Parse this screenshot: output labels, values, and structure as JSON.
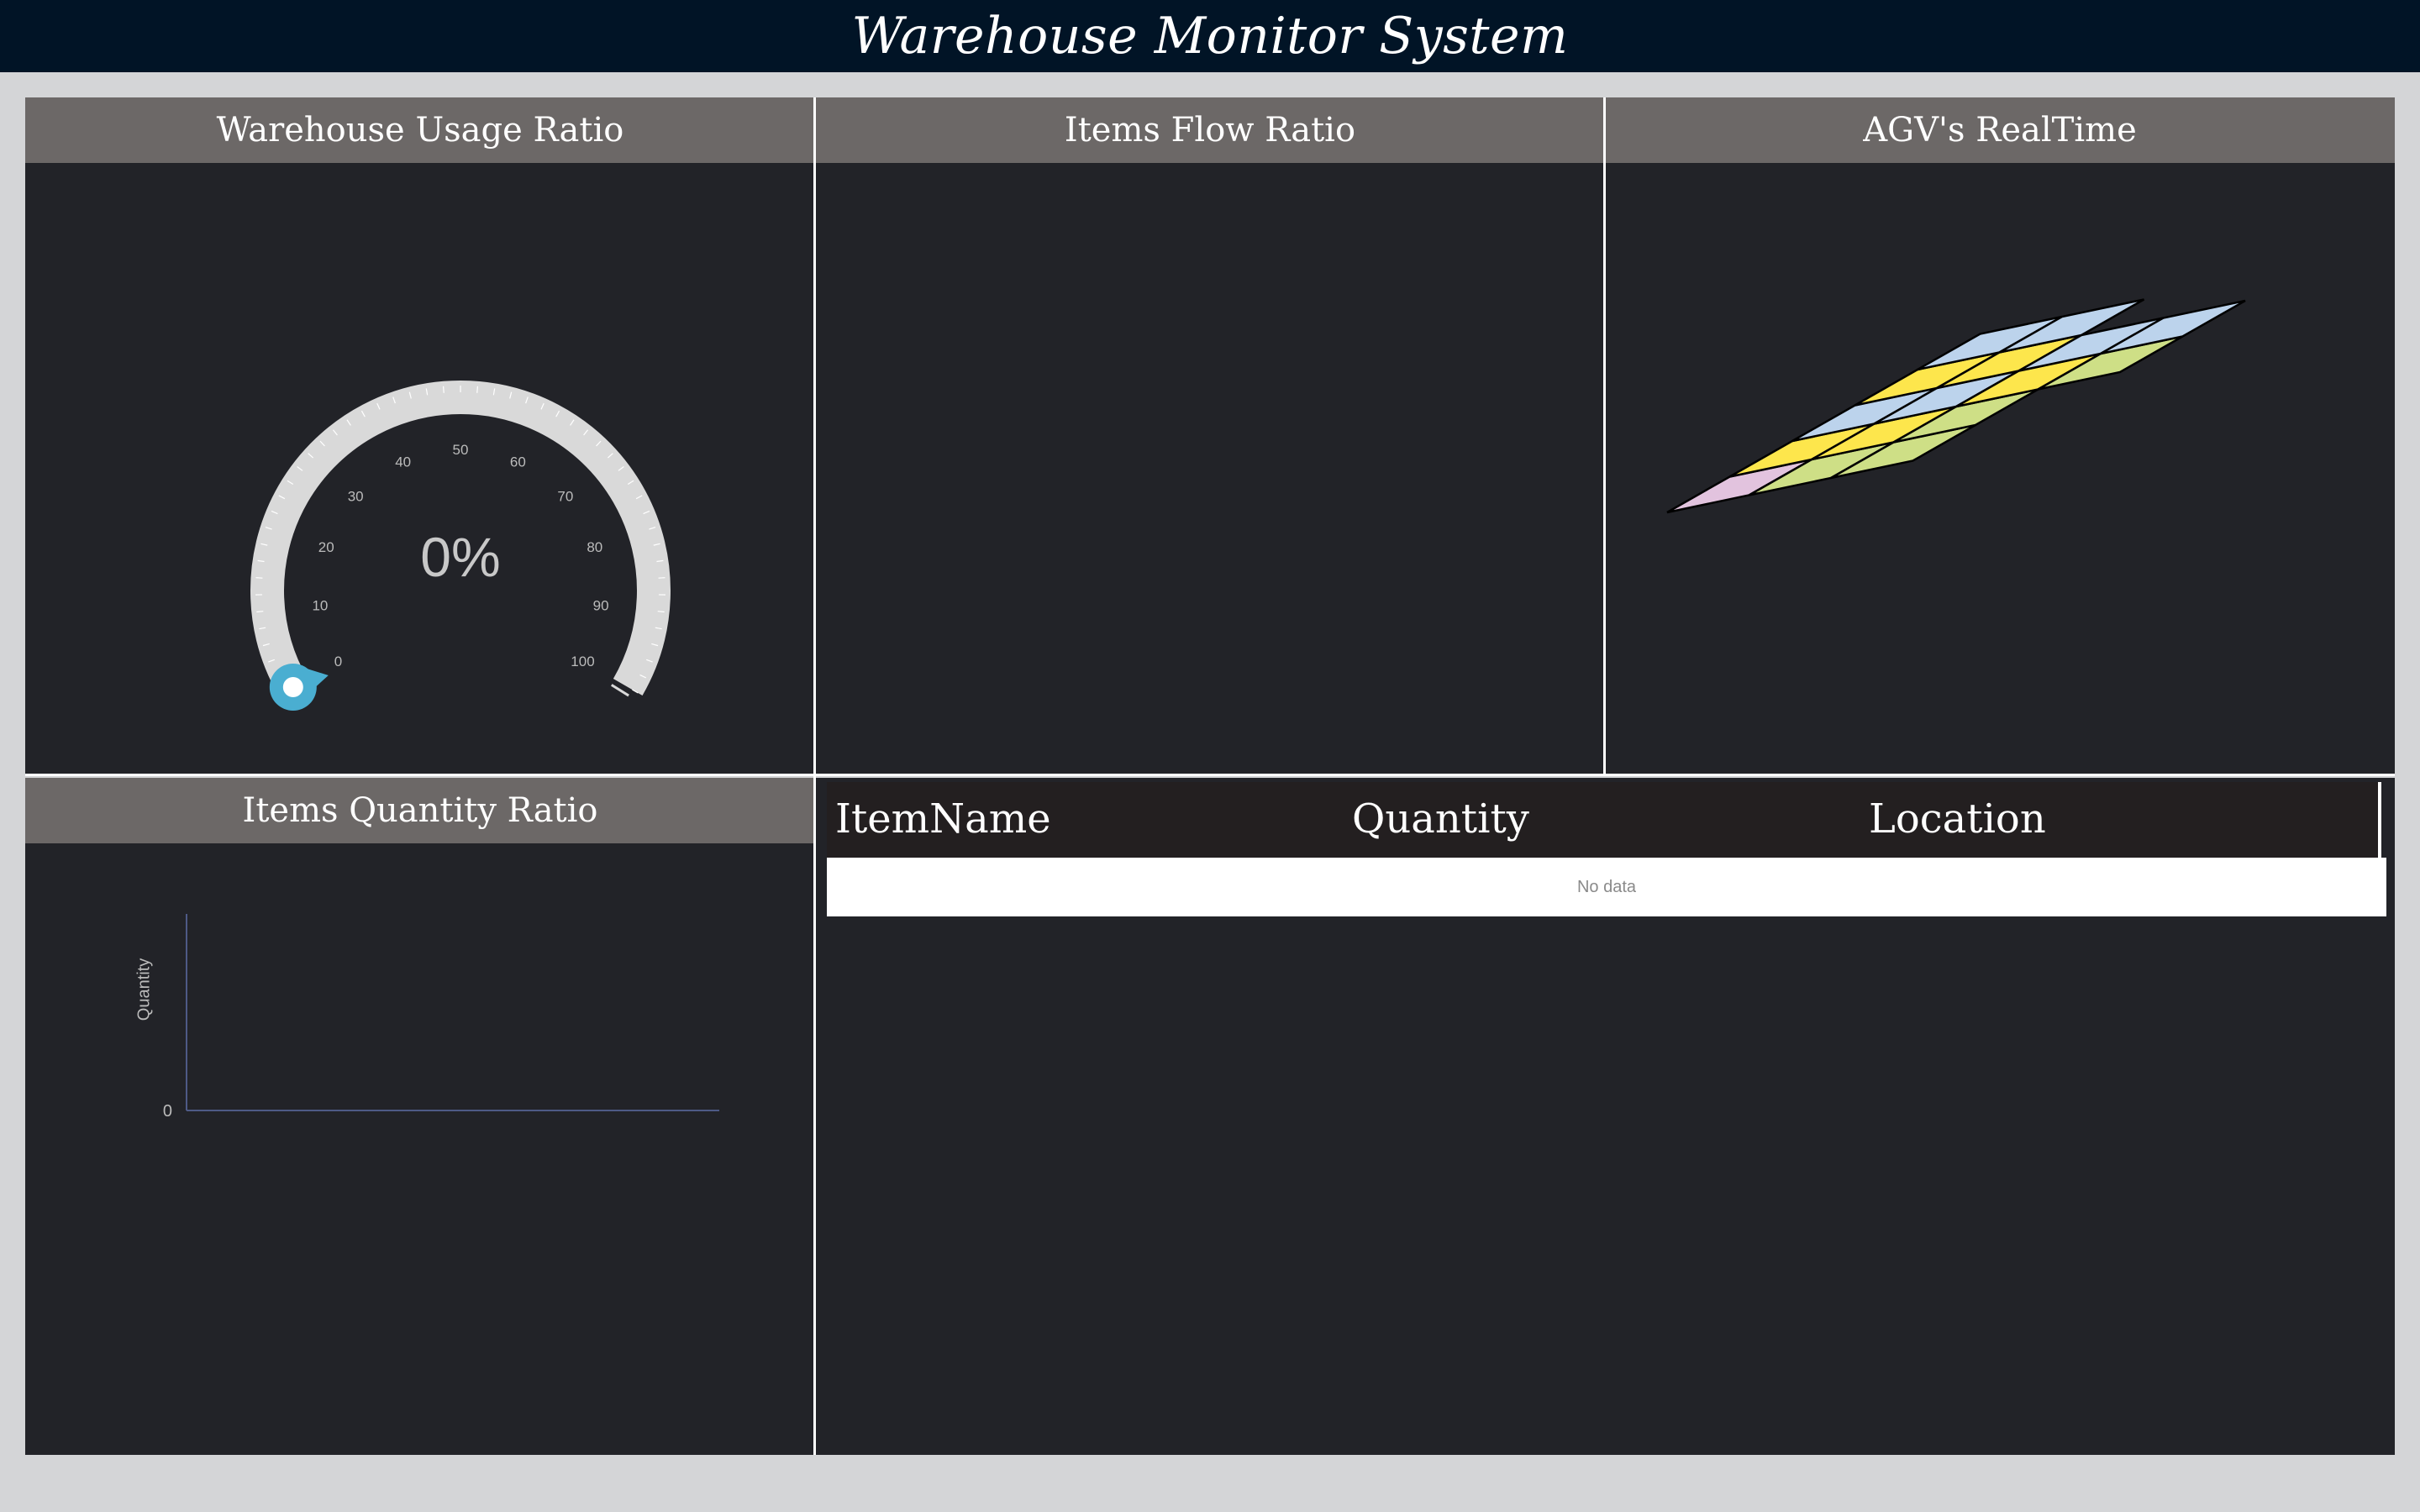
{
  "app": {
    "title": "Warehouse Monitor System"
  },
  "panels": {
    "usage": {
      "title": "Warehouse Usage Ratio",
      "gauge": {
        "value_label": "0%",
        "value": 0,
        "min": 0,
        "max": 100,
        "ticks": [
          "0",
          "10",
          "20",
          "30",
          "40",
          "50",
          "60",
          "70",
          "80",
          "90",
          "100"
        ],
        "pointer_color": "#4aaed1",
        "track_color": "#d9d9d9"
      }
    },
    "flow": {
      "title": "Items Flow Ratio"
    },
    "agv": {
      "title": "AGV's RealTime",
      "colors": {
        "blue": "#bcd3ec",
        "yellow": "#fde64c",
        "green": "#cedf86",
        "pink": "#e2c3de"
      }
    },
    "quantity": {
      "title": "Items Quantity Ratio",
      "chart_data": {
        "type": "bar",
        "categories": [],
        "values": [],
        "title": "",
        "xlabel": "",
        "ylabel": "Quantity",
        "y_tick_labels": [
          "0"
        ]
      }
    },
    "table": {
      "columns": [
        "ItemName",
        "Quantity",
        "Location"
      ],
      "rows": [],
      "empty_text": "No data"
    }
  }
}
